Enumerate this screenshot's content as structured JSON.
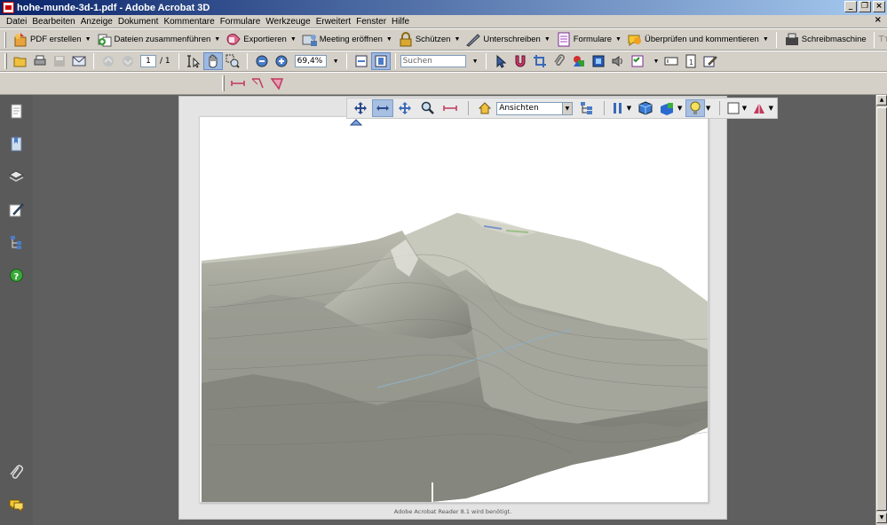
{
  "window": {
    "title": "hohe-munde-3d-1.pdf - Adobe Acrobat 3D"
  },
  "menu": [
    "Datei",
    "Bearbeiten",
    "Anzeige",
    "Dokument",
    "Kommentare",
    "Formulare",
    "Werkzeuge",
    "Erweitert",
    "Fenster",
    "Hilfe"
  ],
  "toolbar1": {
    "pdf_erstellen": "PDF erstellen",
    "dateien_zusammenfuehren": "Dateien zusammenführen",
    "exportieren": "Exportieren",
    "meeting": "Meeting eröffnen",
    "schuetzen": "Schützen",
    "unterschreiben": "Unterschreiben",
    "formulare": "Formulare",
    "ueberpruefen": "Überprüfen und kommentieren",
    "schreibmaschine": "Schreibmaschine"
  },
  "toolbar2": {
    "page_current": "1",
    "page_total": "/ 1",
    "zoom": "69,4%",
    "search_placeholder": "Suchen"
  },
  "toolbar3d": {
    "views_label": "Ansichten"
  },
  "document": {
    "footer_note": "Adobe Acrobat Reader 8.1 wird benötigt."
  },
  "colors": {
    "titlebar_start": "#0a246a",
    "titlebar_end": "#a6caf0",
    "chrome": "#d4d0c8",
    "doc_background": "#5f5f5f",
    "left_nav": "#5a5a5a"
  }
}
